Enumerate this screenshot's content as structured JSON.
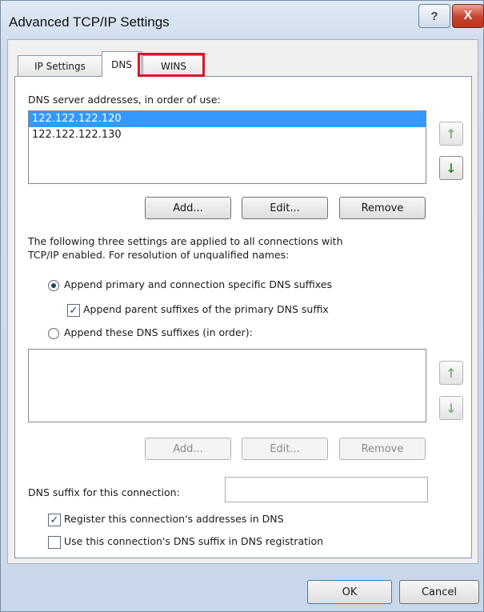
{
  "window": {
    "title": "Advanced TCP/IP Settings",
    "help_glyph": "?",
    "close_glyph": "X"
  },
  "tabs": [
    {
      "label": "IP Settings",
      "selected": false
    },
    {
      "label": "DNS",
      "selected": true
    },
    {
      "label": "WINS",
      "selected": false,
      "highlighted": true
    }
  ],
  "dns": {
    "servers_label": "DNS server addresses, in order of use:",
    "servers": [
      "122.122.122.120",
      "122.122.122.130"
    ],
    "selected_index": 0,
    "up_glyph": "↑",
    "down_glyph": "↓",
    "add_label": "Add...",
    "edit_label": "Edit...",
    "remove_label": "Remove",
    "description": "The following three settings are applied to all connections with",
    "description2": "TCP/IP enabled. For resolution of unqualified names:",
    "radio_primary": "Append primary and connection specific DNS suffixes",
    "checkbox_parent": "Append parent suffixes of the primary DNS suffix",
    "radio_these": "Append these DNS suffixes (in order):",
    "suffixes": [],
    "add2_label": "Add...",
    "edit2_label": "Edit...",
    "remove2_label": "Remove",
    "suffix_label": "DNS suffix for this connection:",
    "suffix_value": "",
    "register_label": "Register this connection's addresses in DNS",
    "use_suffix_label": "Use this connection's DNS suffix in DNS registration",
    "check_glyph": "✓"
  },
  "footer": {
    "ok_label": "OK",
    "cancel_label": "Cancel"
  },
  "colors": {
    "highlight": "#d7172a",
    "selection": "#3399ff"
  }
}
